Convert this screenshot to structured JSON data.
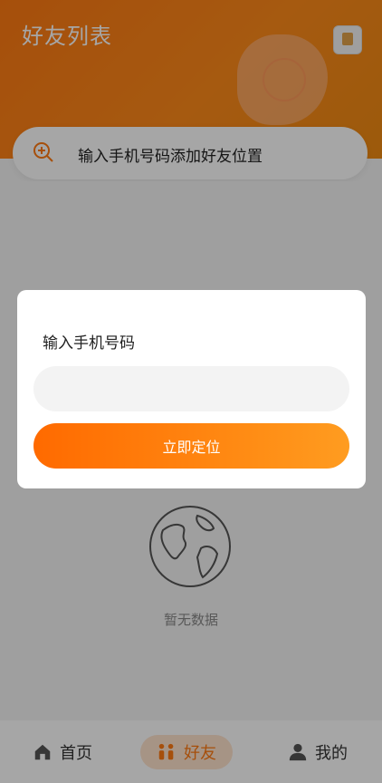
{
  "header": {
    "title": "好友列表"
  },
  "search": {
    "placeholder": "输入手机号码添加好友位置"
  },
  "empty_state": {
    "text": "暂无数据"
  },
  "tabs": [
    {
      "label": "首页",
      "icon": "home-icon"
    },
    {
      "label": "好友",
      "icon": "friends-icon",
      "active": true
    },
    {
      "label": "我的",
      "icon": "user-icon"
    }
  ],
  "modal": {
    "title": "输入手机号码",
    "phone_value": "",
    "button_label": "立即定位"
  },
  "colors": {
    "accent": "#ff7a12",
    "accent_light": "#ffe3cd"
  }
}
